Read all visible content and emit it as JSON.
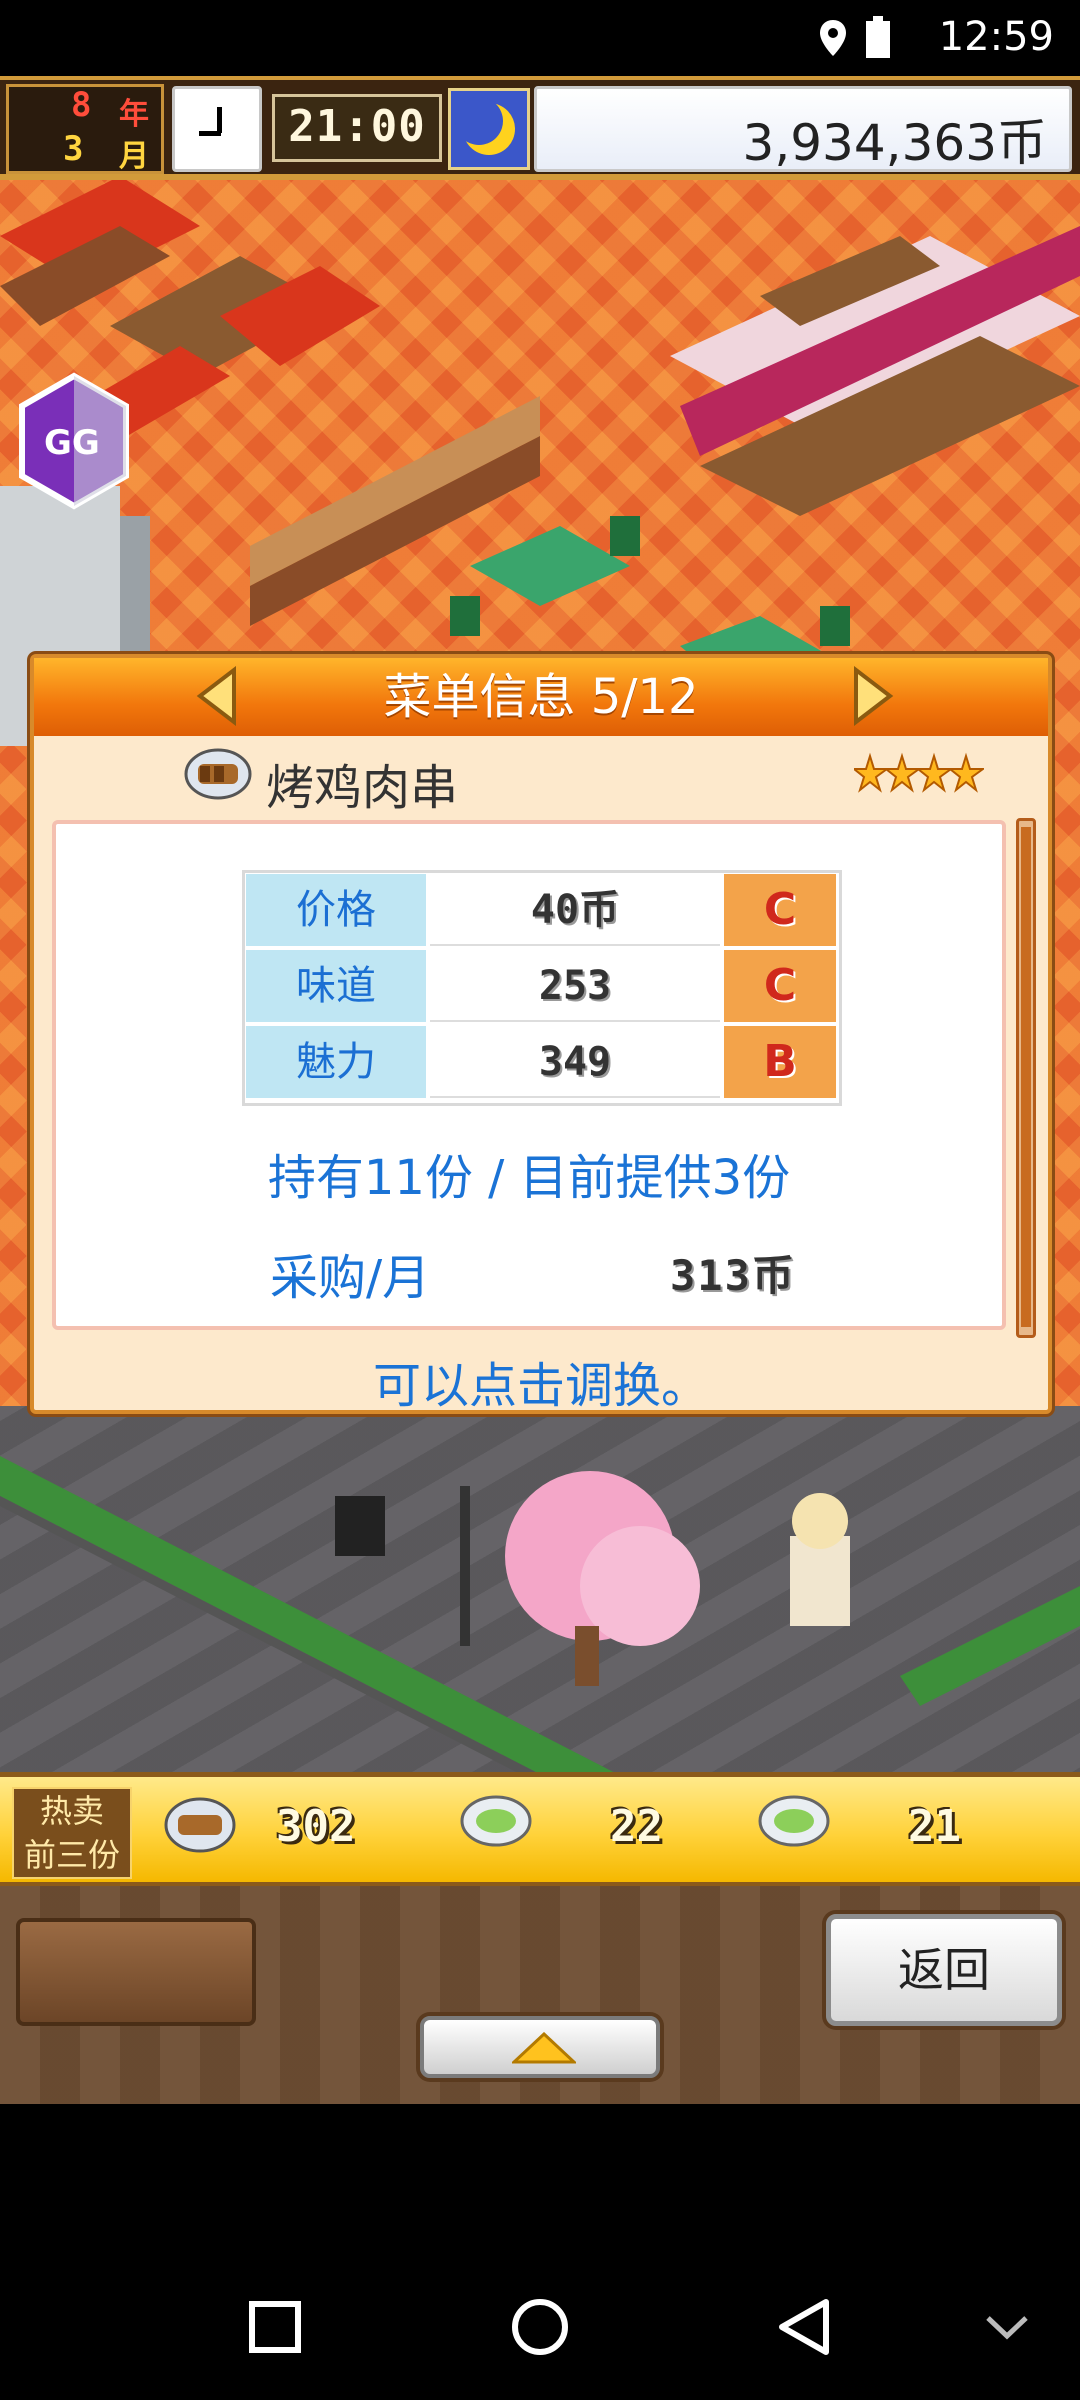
{
  "status_bar": {
    "time": "12:59",
    "icons": [
      "location-icon",
      "battery-icon"
    ]
  },
  "hud": {
    "year_num": "8",
    "year_label": "年",
    "month_num": "3",
    "month_label": "月",
    "digital_time": "21:00",
    "money": "3,934,363币",
    "icons": [
      "clock-icon",
      "moon-icon"
    ]
  },
  "floating_button": {
    "label": "GG",
    "icon": "gg-icon"
  },
  "dialog": {
    "title": "菜单信息 5/12",
    "dish_name": "烤鸡肉串",
    "star_rating": 4,
    "stats": [
      {
        "label": "价格",
        "value": "40币",
        "rank": "C"
      },
      {
        "label": "味道",
        "value": "253",
        "rank": "C"
      },
      {
        "label": "魅力",
        "value": "349",
        "rank": "B"
      }
    ],
    "stock_line": "持有11份 / 目前提供3份",
    "purchase_label": "采购/月",
    "purchase_value": "313币",
    "hint": "可以点击调换。"
  },
  "top3": {
    "label_line1": "热卖",
    "label_line2": "前三份",
    "items": [
      {
        "icon": "skewer-icon",
        "count": "302"
      },
      {
        "icon": "salad-bowl-icon",
        "count": "22"
      },
      {
        "icon": "salad-bowl-icon",
        "count": "21"
      }
    ]
  },
  "bottom": {
    "return_label": "返回"
  },
  "colors": {
    "accent_orange": "#f2770c",
    "text_blue": "#1a73d6",
    "rank_bg": "#f3a34a",
    "stat_label_bg": "#bfe6f3"
  },
  "nav_icons": [
    "recents-square-icon",
    "home-circle-icon",
    "back-triangle-icon",
    "chevron-down-icon"
  ]
}
